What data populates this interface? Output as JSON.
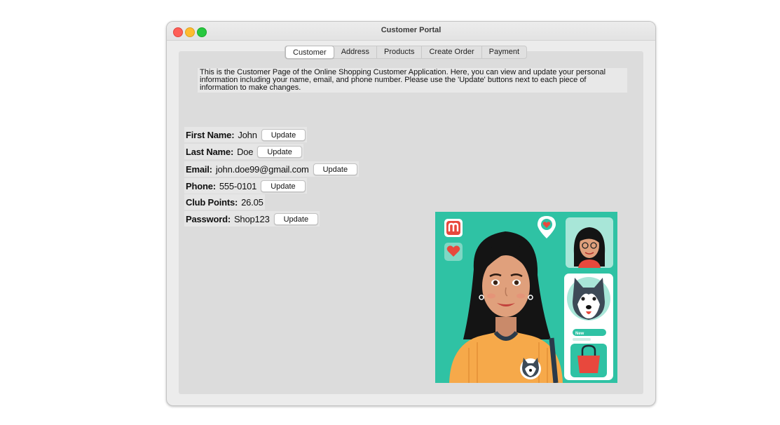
{
  "window": {
    "title": "Customer Portal"
  },
  "tabs": [
    {
      "label": "Customer",
      "active": true
    },
    {
      "label": "Address",
      "active": false
    },
    {
      "label": "Products",
      "active": false
    },
    {
      "label": "Create Order",
      "active": false
    },
    {
      "label": "Payment",
      "active": false
    }
  ],
  "intro": "This is the Customer Page of the Online Shopping Customer Application. Here, you can view and update your personal information including your name, email, and phone number. Please use the 'Update' buttons next to each piece of information to make changes.",
  "fields": [
    {
      "label": "First Name:",
      "value": "John",
      "button": "Update"
    },
    {
      "label": "Last Name:",
      "value": "Doe",
      "button": "Update"
    },
    {
      "label": "Email:",
      "value": "john.doe99@gmail.com",
      "button": "Update"
    },
    {
      "label": "Phone:",
      "value": "555-0101",
      "button": "Update"
    },
    {
      "label": "Club Points:",
      "value": "26.05"
    },
    {
      "label": "Password:",
      "value": "Shop123",
      "button": "Update"
    }
  ],
  "image": {
    "badge_text": "New",
    "icons": [
      "app-logo-icon",
      "heart-icon",
      "location-heart-icon",
      "shopping-bag-icon"
    ]
  },
  "colors": {
    "image_bg": "#2fc2a4",
    "accent_red": "#e8483d"
  }
}
